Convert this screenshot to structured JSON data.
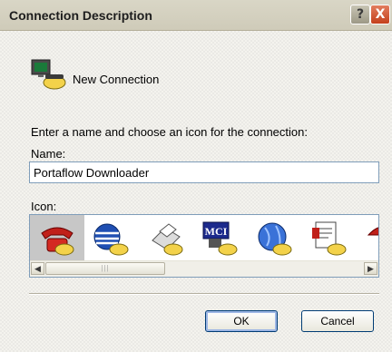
{
  "window": {
    "title": "Connection Description",
    "help_button": "?",
    "close_button": "X"
  },
  "header": {
    "label": "New Connection",
    "icon": "new-connection-icon"
  },
  "form": {
    "instruction": "Enter a name and choose an icon for the connection:",
    "name_label": "Name:",
    "name_value": "Portaflow Downloader",
    "icon_label": "Icon:",
    "icons": [
      {
        "name": "red-phone-icon",
        "selected": true
      },
      {
        "name": "globe-phone-icon",
        "selected": false
      },
      {
        "name": "fax-phone-icon",
        "selected": false
      },
      {
        "name": "mci-phone-icon",
        "selected": false
      },
      {
        "name": "globe-blue-phone-icon",
        "selected": false
      },
      {
        "name": "document-phone-icon",
        "selected": false
      },
      {
        "name": "umbrella-phone-icon",
        "selected": false
      }
    ]
  },
  "buttons": {
    "ok": "OK",
    "cancel": "Cancel"
  },
  "scrollbar": {
    "left_arrow": "◀",
    "right_arrow": "▶",
    "thumb_grip": "|||"
  },
  "icon_texts": {
    "mci": "MCI"
  }
}
